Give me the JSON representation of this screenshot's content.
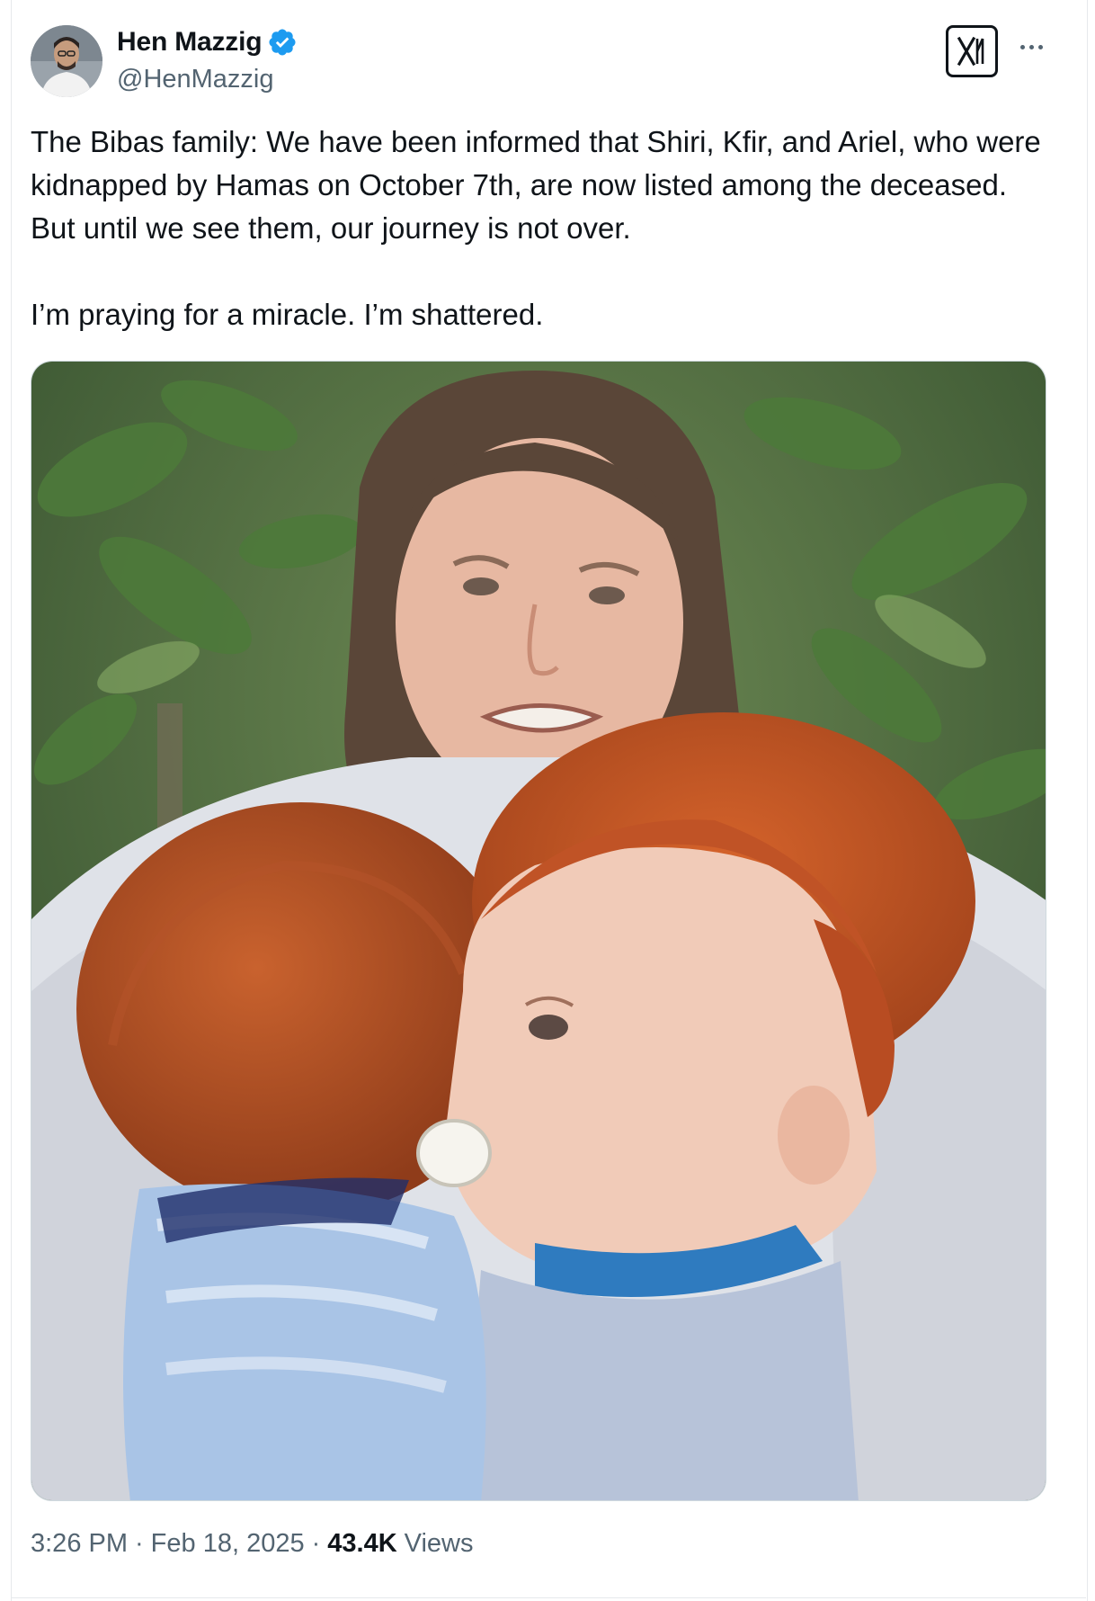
{
  "author": {
    "display_name": "Hen Mazzig",
    "handle": "@HenMazzig",
    "verified": true,
    "verified_color": "#1d9bf0"
  },
  "tweet": {
    "paragraphs": [
      "The Bibas family: We have been informed that Shiri, Kfir, and Ariel, who were kidnapped by Hamas on October 7th, are now listed among the deceased. But until we see them, our journey is not over.",
      "I’m praying for a miracle. I’m shattered."
    ]
  },
  "meta": {
    "time": "3:26 PM",
    "date": "Feb 18, 2025",
    "separator": "·",
    "views_count": "43.4K",
    "views_label": "Views"
  },
  "icons": {
    "verified": "verified-badge-icon",
    "platform": "x-logo-icon",
    "more": "more-options-icon"
  },
  "colors": {
    "text_primary": "#0f1419",
    "text_secondary": "#536471",
    "border": "#cfd9de"
  }
}
